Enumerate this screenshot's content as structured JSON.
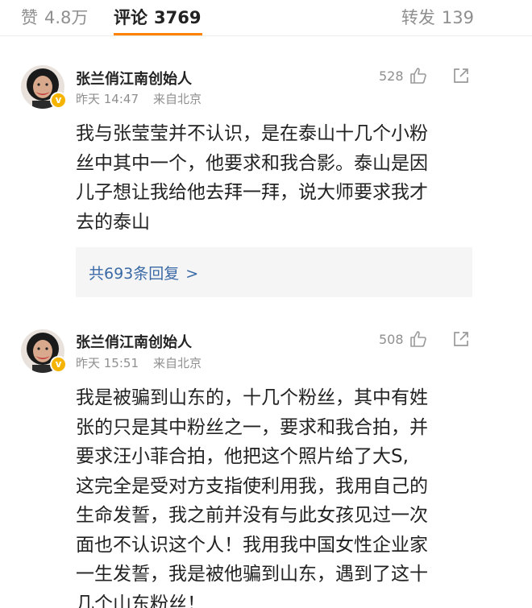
{
  "tabs": {
    "like": {
      "label": "赞",
      "count": "4.8万"
    },
    "comment": {
      "label": "评论",
      "count": "3769"
    },
    "repost": {
      "label": "转发",
      "count": "139"
    }
  },
  "colors": {
    "accent": "#ff8200",
    "link": "#3a6aa6",
    "verified_badge": "#f5b400"
  },
  "comments": [
    {
      "avatar_icon": "user-avatar",
      "verified_icon": "verified-badge-icon",
      "username": "张兰俏江南创始人",
      "time": "昨天 14:47",
      "source": "来自北京",
      "likes": "528",
      "text_lines": [
        "我与张莹莹并不认识，是在泰山十几个小粉",
        "丝中其中一个，他要求和我合影。泰山是因",
        "儿子想让我给他去拜一拜，说大师要求我才",
        "去的泰山"
      ],
      "replies_text": "共693条回复",
      "replies_arrow": ">"
    },
    {
      "avatar_icon": "user-avatar",
      "verified_icon": "verified-badge-icon",
      "username": "张兰俏江南创始人",
      "time": "昨天 15:51",
      "source": "来自北京",
      "likes": "508",
      "text_lines": [
        "我是被骗到山东的，十几个粉丝，其中有姓",
        "张的只是其中粉丝之一，要求和我合拍，并",
        "要求汪小菲合拍，他把这个照片给了大S,",
        "这完全是受对方支指使利用我，我用自己的",
        "生命发誓，我之前并没有与此女孩见过一次",
        "面也不认识这个人！我用我中国女性企业家",
        "一生发誓，我是被他骗到山东，遇到了这十",
        "几个山东粉丝！"
      ]
    }
  ]
}
